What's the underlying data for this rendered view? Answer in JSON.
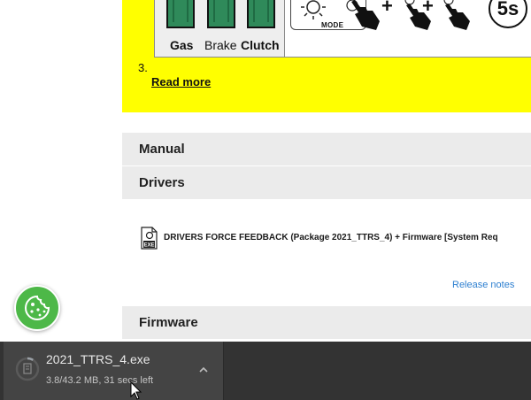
{
  "notice": {
    "pedals": [
      {
        "label": "Gas",
        "bold": true
      },
      {
        "label": "Brake",
        "bold": false
      },
      {
        "label": "Clutch",
        "bold": true
      }
    ],
    "mode_label": "MODE",
    "timer_label": "5s",
    "plus_signs": [
      "+",
      "+"
    ],
    "list_number": "3.",
    "read_more": "Read more",
    "background_color": "#ffff00"
  },
  "sections": {
    "manual": "Manual",
    "drivers": "Drivers",
    "firmware": "Firmware"
  },
  "drivers": {
    "file_icon": "exe-file-icon",
    "link_text": "DRIVERS FORCE FEEDBACK (Package 2021_TTRS_4) + Firmware [System Req",
    "release_notes": "Release notes"
  },
  "cookie_button": {
    "icon": "cookie-icon",
    "color": "#4db848"
  },
  "download": {
    "file_name": "2021_TTRS_4.exe",
    "status": "3.8/43.2 MB, 31 secs left",
    "progress": 0.088
  }
}
